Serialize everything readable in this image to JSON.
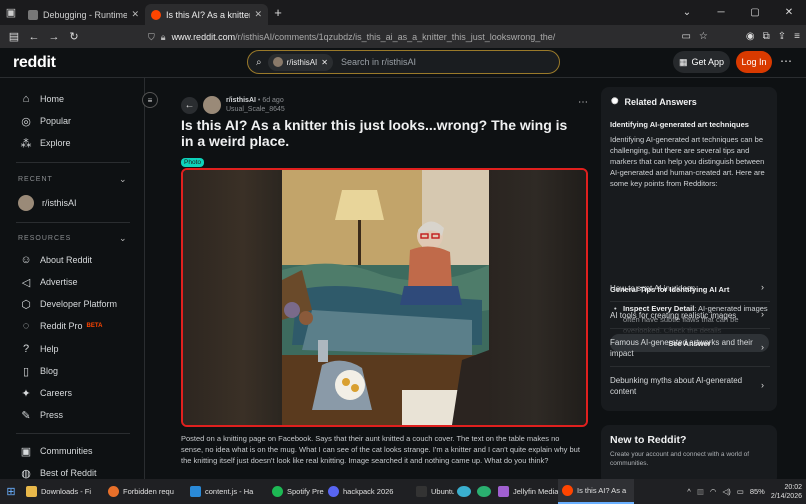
{
  "browser": {
    "tabs": [
      {
        "title": "Debugging - Runtime / this-fire",
        "active": false
      },
      {
        "title": "Is this AI? As a knitter this just lo",
        "active": true
      }
    ],
    "url_host": "www.reddit.com",
    "url_path": "/r/isthisAI/comments/1qzubdz/is_this_ai_as_a_knitter_this_just_lookswrong_the/"
  },
  "header": {
    "logo": "reddit",
    "search_chip": "r/isthisAI",
    "search_placeholder": "Search in r/isthisAI",
    "get_app": "Get App",
    "login": "Log In"
  },
  "sidebar": {
    "nav": [
      "Home",
      "Popular",
      "Explore"
    ],
    "recent_heading": "RECENT",
    "recent_item": "r/isthisAI",
    "resources_heading": "RESOURCES",
    "resources": [
      "About Reddit",
      "Advertise",
      "Developer Platform",
      "Reddit Pro",
      "Help",
      "Blog",
      "Careers",
      "Press"
    ],
    "beta": "BETA",
    "bottom": [
      "Communities",
      "Best of Reddit"
    ]
  },
  "post": {
    "subreddit": "r/isthisAI",
    "age": "6d ago",
    "username": "Usual_Scale_8645",
    "title": "Is this AI? As a knitter this just looks...wrong? The wing is in a weird place.",
    "flair": "Photo",
    "body": "Posted on a knitting page on Facebook. Says that their aunt knitted a couch cover. The text on the table makes no sense, no idea what is on the mug. What I can see of the cat looks strange. I'm a knitter and I can't quite explain why but the knitting itself just doesn't look like real knitting. Image searched it and nothing came up. What do you think?"
  },
  "related": {
    "heading": "Related Answers",
    "question": "Identifying AI-generated art techniques",
    "answer": "Identifying AI-generated art techniques can be challenging, but there are several tips and markers that can help you distinguish between AI-generated and human-created art. Here are some key points from Redditors:",
    "subheading": "General Tips for Identifying AI Art",
    "bullet_bold": "Inspect Every Detail",
    "bullet_text": ": AI-generated images often have subtle flaws that can be overlooked. Check the details",
    "see_answer": "See Answer",
    "questions": [
      "How to spot AI in videos",
      "AI tools for creating realistic images",
      "Famous AI-generated artworks and their impact",
      "Debunking myths about AI-generated content"
    ]
  },
  "new_to_reddit": {
    "title": "New to Reddit?",
    "text": "Create your account and connect with a world of communities."
  },
  "taskbar": {
    "apps": [
      "Downloads - Fi",
      "Forbidden requ",
      "content.js - Ha",
      "Spotify Prem",
      "hackpack 2026",
      "Ubuntu",
      "Jellyfin Media",
      "Is this AI? As a"
    ],
    "battery": "85%",
    "time": "20:02",
    "date": "2/14/2026"
  },
  "colors": {
    "accent": "#d93a00",
    "highlight": "#e0201e",
    "flair": "#0dd3bb"
  }
}
